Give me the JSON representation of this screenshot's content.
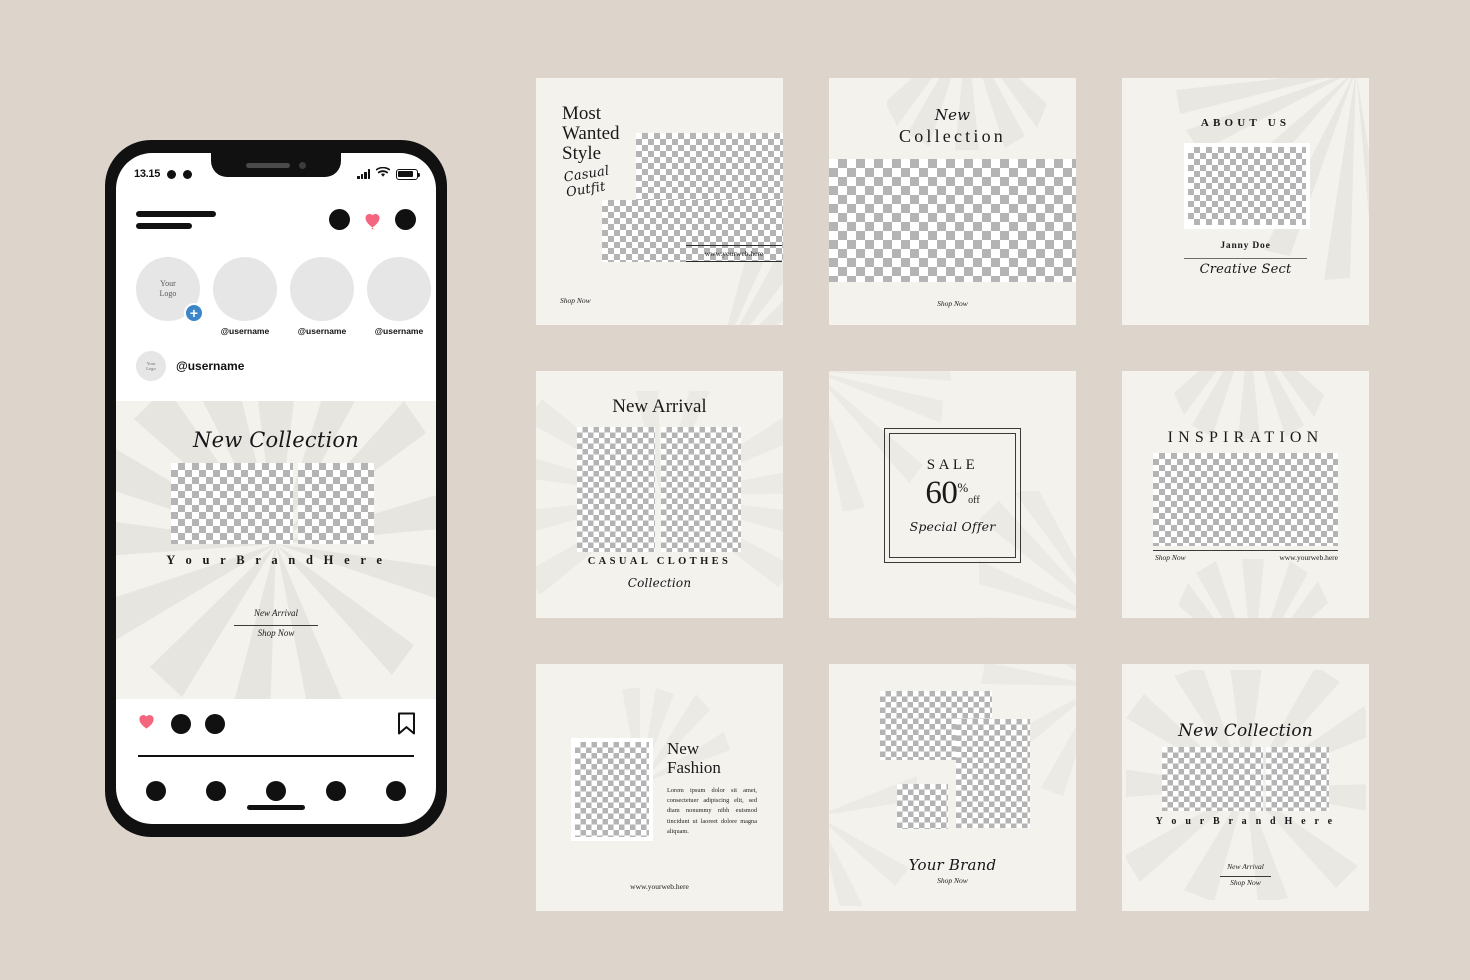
{
  "phone": {
    "status": {
      "time": "13.15"
    },
    "header": {
      "icons": [
        "dot-icon",
        "heart-icon",
        "dot-icon"
      ]
    },
    "stories": [
      {
        "label": "Your\nLogo",
        "username": "",
        "has_add": true
      },
      {
        "label": "",
        "username": "@username",
        "has_add": false
      },
      {
        "label": "",
        "username": "@username",
        "has_add": false
      },
      {
        "label": "",
        "username": "@username",
        "has_add": false
      }
    ],
    "post_user": {
      "avatar_label": "Your Logo",
      "username": "@username"
    },
    "post": {
      "title": "New Collection",
      "brand": "Y o u r   B r a n d   H e r e",
      "new_arrival": "New Arrival",
      "shop_now": "Shop Now"
    },
    "actions": {
      "like": "heart-icon",
      "comment": "dot-icon",
      "share": "dot-icon",
      "save": "bookmark-icon"
    },
    "tabs": [
      "home-dot",
      "search-dot",
      "reels-dot",
      "shop-dot",
      "profile-dot"
    ]
  },
  "cards": {
    "most_wanted": {
      "title_line1": "Most",
      "title_line2": "Wanted",
      "title_line3": "Style",
      "script_line1": "Casual",
      "script_line2": "Outfit",
      "url": "www.yourweb.here",
      "shop_now": "Shop Now"
    },
    "new_collection": {
      "script": "New",
      "title": "Collection",
      "shop_now": "Shop Now"
    },
    "about_us": {
      "title": "ABOUT US",
      "name": "Janny Doe",
      "role": "Creative Sect"
    },
    "new_arrival": {
      "title": "New Arrival",
      "subtitle": "CASUAL CLOTHES",
      "script": "Collection"
    },
    "sale": {
      "label": "SALE",
      "number": "60",
      "percent": "%",
      "off": "off",
      "script": "Special Offer"
    },
    "inspiration": {
      "title": "INSPIRATION",
      "shop_now": "Shop Now",
      "url": "www.yourweb.here"
    },
    "new_fashion": {
      "title_line1": "New",
      "title_line2": "Fashion",
      "body": "Lorem ipsum dolor sit amet, consectetuer adipiscing elit, sed diam nonummy nibh euismod tincidunt ut laoreet dolore magna aliquam.",
      "url": "www.yourweb.here"
    },
    "your_brand": {
      "script": "Your Brand",
      "shop_now": "Shop Now"
    },
    "new_collection_2": {
      "script": "New Collection",
      "brand": "Y o u r   B r a n d   H e r e",
      "new_arrival": "New Arrival",
      "shop_now": "Shop Now"
    }
  },
  "colors": {
    "page_background": "#ddd5cb",
    "card_background": "#f4f2ed",
    "ink": "#1a1a1a",
    "accent_heart": "#f4667d",
    "accent_blue": "#3b86c8",
    "placeholder_gray": "#b4b4b4"
  }
}
